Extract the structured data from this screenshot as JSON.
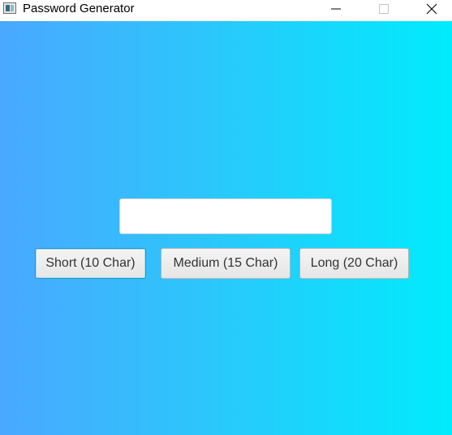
{
  "window": {
    "title": "Password Generator",
    "icon": "app-window-icon"
  },
  "title_controls": {
    "minimize_icon": "minimize-icon",
    "maximize_icon": "maximize-icon",
    "close_icon": "close-icon"
  },
  "password": {
    "value": "",
    "placeholder": ""
  },
  "buttons": {
    "short_label": "Short (10 Char)",
    "medium_label": "Medium (15 Char)",
    "long_label": "Long (20 Char)"
  },
  "colors": {
    "gradient_start": "#4aa8ff",
    "gradient_end": "#00ebfc",
    "focus_border": "#1f97c9"
  }
}
